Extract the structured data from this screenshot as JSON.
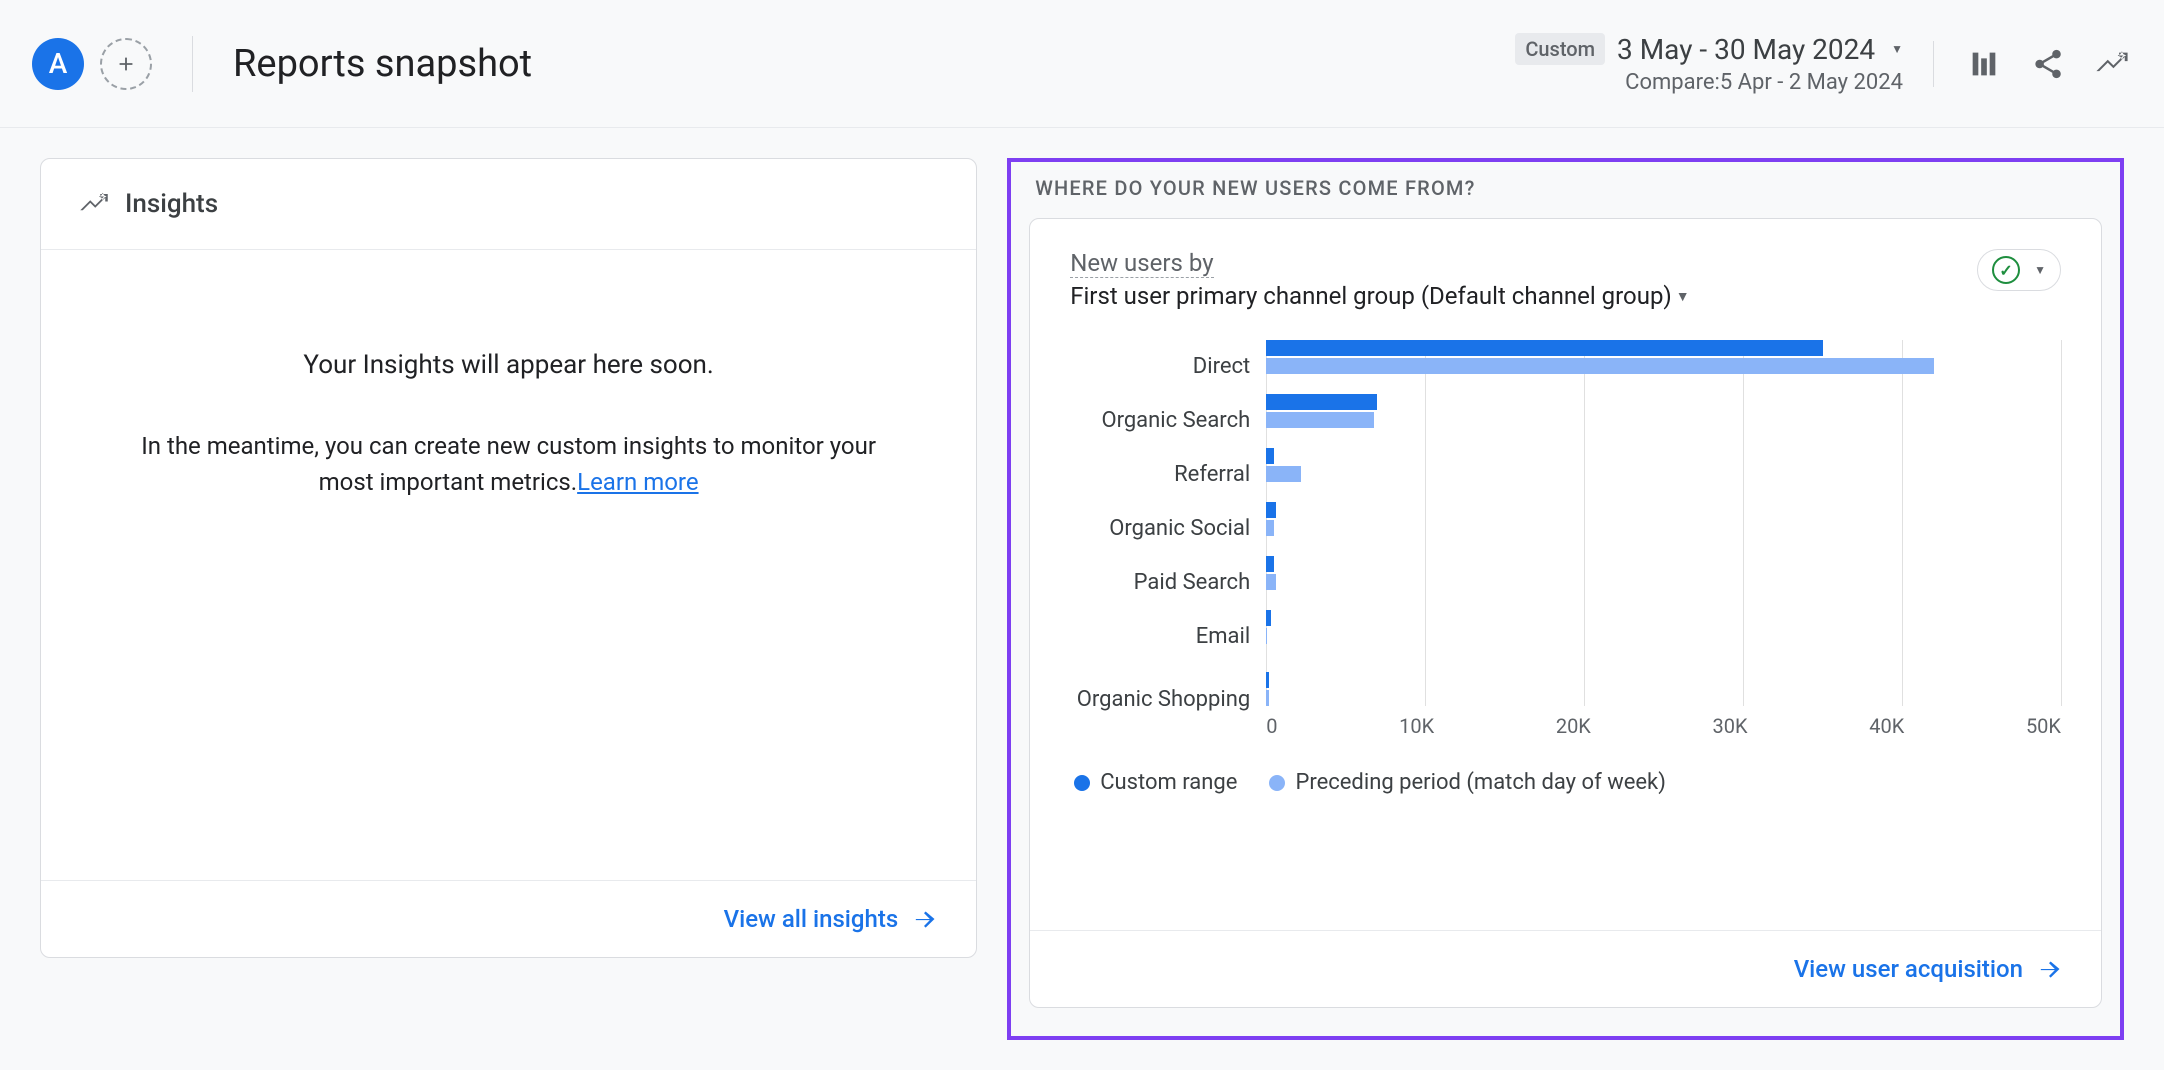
{
  "header": {
    "avatar_letter": "A",
    "title": "Reports snapshot",
    "custom_tag": "Custom",
    "date_range": "3 May - 30 May 2024",
    "compare_range": "Compare:5 Apr - 2 May 2024"
  },
  "insights": {
    "heading": "Insights",
    "empty_title": "Your Insights will appear here soon.",
    "empty_text_1": "In the meantime, you can create new custom insights to monitor your most important metrics.",
    "learn_more": "Learn more",
    "footer_link": "View all insights"
  },
  "acquisition": {
    "section_title": "WHERE DO YOUR NEW USERS COME FROM?",
    "metric_label": "New users by",
    "dimension": "First user primary channel group (Default channel group)",
    "footer_link": "View user acquisition",
    "legend_primary": "Custom range",
    "legend_secondary": "Preceding period (match day of week)"
  },
  "chart_data": {
    "type": "bar",
    "orientation": "horizontal",
    "xlabel": "",
    "ylabel": "",
    "xlim": [
      0,
      50000
    ],
    "ticks": [
      "0",
      "10K",
      "20K",
      "30K",
      "40K",
      "50K"
    ],
    "categories": [
      "Direct",
      "Organic Search",
      "Referral",
      "Organic Social",
      "Paid Search",
      "Email",
      "Organic Shopping"
    ],
    "series": [
      {
        "name": "Custom range",
        "values": [
          35000,
          7000,
          500,
          600,
          500,
          300,
          200
        ]
      },
      {
        "name": "Preceding period (match day of week)",
        "values": [
          42000,
          6800,
          2200,
          500,
          600,
          80,
          150
        ]
      }
    ]
  }
}
